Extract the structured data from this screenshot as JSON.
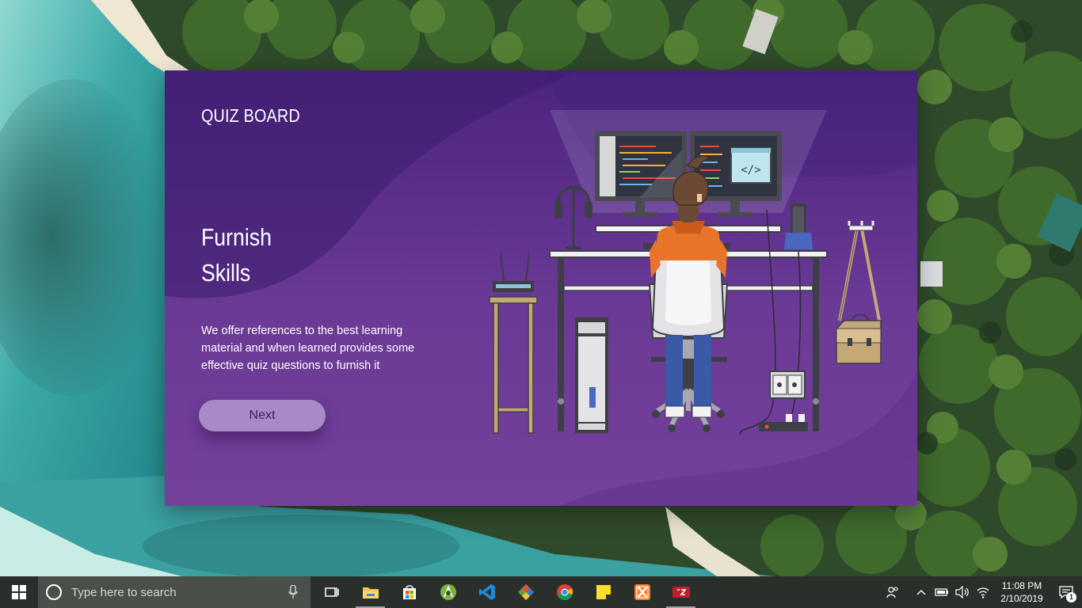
{
  "app": {
    "brand": "QUIZ BOARD",
    "headline": [
      "Furnish",
      "Skills"
    ],
    "description": "We offer references to the best learning material and when learned provides some effective quiz questions to furnish it",
    "next_label": "Next",
    "illustration_code_symbol": "</>"
  },
  "taskbar": {
    "search_placeholder": "Type here to search",
    "pinned": [
      "task-view",
      "file-explorer",
      "microsoft-store",
      "android-studio",
      "vs-code",
      "git",
      "chrome",
      "sticky-notes",
      "xampp",
      "filezilla"
    ],
    "time": "11:08 PM",
    "date": "2/10/2019",
    "notification_count": "1"
  },
  "colors": {
    "window_top": "#4b2480",
    "window_bottom": "#74419a",
    "button": "#a98ac6",
    "taskbar": "#2b2f2b"
  }
}
